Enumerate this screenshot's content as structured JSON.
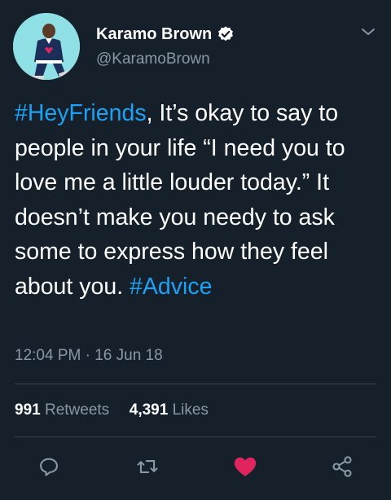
{
  "user": {
    "display_name": "Karamo Brown",
    "handle": "@KaramoBrown"
  },
  "tweet": {
    "segments": [
      {
        "text": "#HeyFriends",
        "hashtag": true
      },
      {
        "text": ", It’s okay to say to people in your life “I need you to love me a little louder today.” It doesn’t make you needy to ask some to express how they feel about you. ",
        "hashtag": false
      },
      {
        "text": "#Advice",
        "hashtag": true
      }
    ],
    "timestamp": "12:04 PM · 16 Jun 18"
  },
  "stats": {
    "retweets_count": "991",
    "retweets_label": "Retweets",
    "likes_count": "4,391",
    "likes_label": "Likes"
  },
  "actions": {
    "reply_icon": "reply-icon",
    "retweet_icon": "retweet-icon",
    "like_icon": "heart-icon",
    "share_icon": "share-icon",
    "liked": true
  },
  "colors": {
    "background": "#15202b",
    "hashtag": "#1da1f2",
    "secondary_text": "#8899a6",
    "like": "#e0245e",
    "divider": "#38444d"
  }
}
